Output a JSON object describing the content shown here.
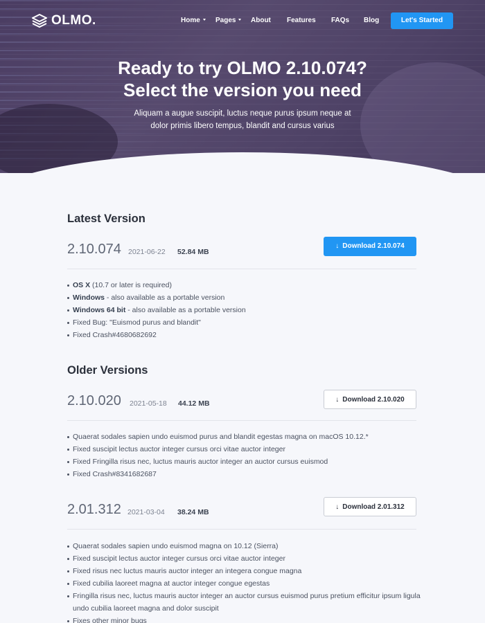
{
  "nav": {
    "logo": "OLMO.",
    "items": [
      {
        "label": "Home",
        "dropdown": true
      },
      {
        "label": "Pages",
        "dropdown": true
      },
      {
        "label": "About",
        "dropdown": false
      },
      {
        "label": "Features",
        "dropdown": false
      },
      {
        "label": "FAQs",
        "dropdown": false
      },
      {
        "label": "Blog",
        "dropdown": false
      }
    ],
    "cta": "Let's Started"
  },
  "hero": {
    "title_line1": "Ready to try OLMO 2.10.074?",
    "title_line2": "Select the version you need",
    "subtitle_line1": "Aliquam a augue suscipit, luctus neque purus ipsum neque at",
    "subtitle_line2": "dolor primis libero tempus, blandit and cursus varius"
  },
  "latest": {
    "section_title": "Latest Version",
    "version": "2.10.074",
    "date": "2021-06-22",
    "size": "52.84 MB",
    "button": "Download 2.10.074",
    "notes": [
      {
        "bold": "OS X",
        "text": " (10.7 or later is required)"
      },
      {
        "bold": "Windows",
        "text": " - also available as a portable version"
      },
      {
        "bold": "Windows 64 bit",
        "text": " - also available as a portable version"
      },
      {
        "bold": "",
        "text": "Fixed Bug: \"Euismod purus and blandit\""
      },
      {
        "bold": "",
        "text": "Fixed Crash#4680682692"
      }
    ]
  },
  "older": {
    "section_title": "Older Versions",
    "versions": [
      {
        "version": "2.10.020",
        "date": "2021-05-18",
        "size": "44.12 MB",
        "button": "Download 2.10.020",
        "notes": [
          "Quaerat sodales sapien undo euismod purus and blandit egestas magna on macOS 10.12.*",
          "Fixed suscipit lectus auctor integer cursus orci vitae auctor integer",
          "Fixed Fringilla risus nec, luctus mauris auctor integer an auctor cursus euismod",
          "Fixed Crash#8341682687"
        ]
      },
      {
        "version": "2.01.312",
        "date": "2021-03-04",
        "size": "38.24 MB",
        "button": "Download 2.01.312",
        "notes": [
          "Quaerat sodales sapien undo euismod magna on 10.12 (Sierra)",
          "Fixed suscipit lectus auctor integer cursus orci vitae auctor integer",
          "Fixed risus nec luctus mauris auctor integer an integera congue magna",
          "Fixed cubilia laoreet magna at auctor integer congue egestas",
          "Fringilla risus nec, luctus mauris auctor integer an auctor cursus euismod purus pretium efficitur ipsum ligula undo cubilia laoreet magna and dolor suscipit",
          "Fixes other minor bugs"
        ]
      }
    ]
  },
  "colors": {
    "accent": "#2196f3",
    "hero": "#4e4266",
    "background": "#f6f7fb"
  }
}
